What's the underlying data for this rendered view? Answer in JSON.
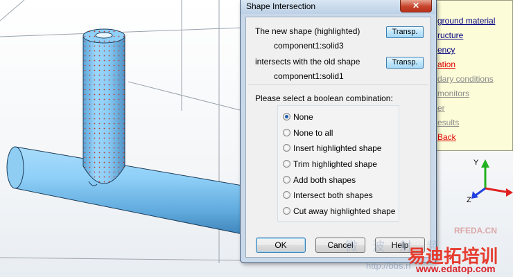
{
  "dialog": {
    "title": "Shape Intersection",
    "close_label": "✕",
    "new_shape_label": "The new shape (highlighted)",
    "new_shape_name": "component1:solid3",
    "old_shape_label": "intersects with the old shape",
    "old_shape_name": "component1:solid1",
    "transp_label": "Transp.",
    "combination_prompt": "Please select a boolean combination:",
    "options": [
      {
        "label": "None",
        "checked": true
      },
      {
        "label": "None to all",
        "checked": false
      },
      {
        "label": "Insert highlighted shape",
        "checked": false
      },
      {
        "label": "Trim highlighted shape",
        "checked": false
      },
      {
        "label": "Add both shapes",
        "checked": false
      },
      {
        "label": "Intersect both shapes",
        "checked": false
      },
      {
        "label": "Cut away highlighted shape",
        "checked": false
      }
    ],
    "ok_label": "OK",
    "cancel_label": "Cancel",
    "help_label": "Help"
  },
  "help_panel": {
    "items": [
      {
        "label": "ground material",
        "style": "active"
      },
      {
        "label": "ructure",
        "style": "active"
      },
      {
        "label": "ency",
        "style": "active"
      },
      {
        "label": "ation",
        "style": "red"
      },
      {
        "label": "dary conditions",
        "style": "grey"
      },
      {
        "label": "monitors",
        "style": "grey"
      },
      {
        "label": "er",
        "style": "grey"
      },
      {
        "label": "esults",
        "style": "grey"
      },
      {
        "label": "Back",
        "style": "red"
      }
    ]
  },
  "axes": {
    "y_label": "Y",
    "z_label": "Z"
  },
  "watermark": {
    "brand": "易迪拓培训",
    "url": "www.edatop.com",
    "site": "RFEDA.CN",
    "faint_text": "微 波 射 频",
    "faint_url": "http://bbs.rf"
  },
  "colors": {
    "shape_blue": "#7fc6f2",
    "highlight_dots": "#c0392b",
    "axis_x": "#e02020",
    "axis_y": "#20b020",
    "axis_z": "#2040e0"
  }
}
